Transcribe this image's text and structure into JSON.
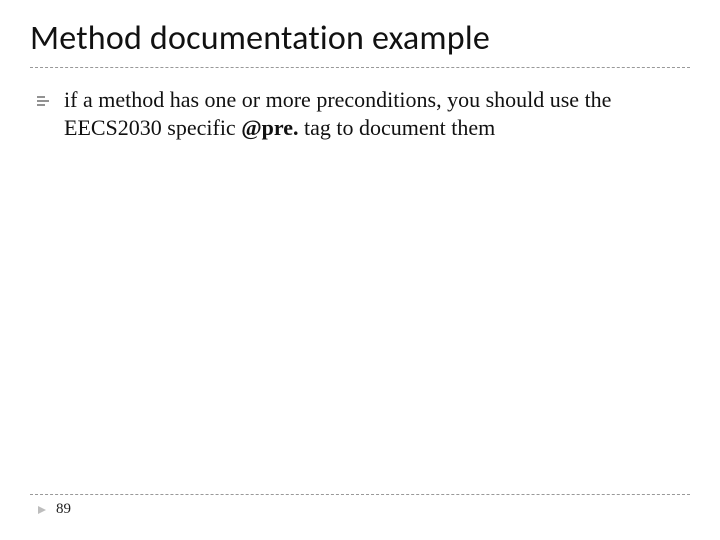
{
  "slide": {
    "title": "Method documentation example",
    "bullet": {
      "pre": "if a method has one or more preconditions, you should use the EECS2030 specific ",
      "tag": "@pre.",
      "post": " tag to document them"
    },
    "page_number": "89"
  }
}
